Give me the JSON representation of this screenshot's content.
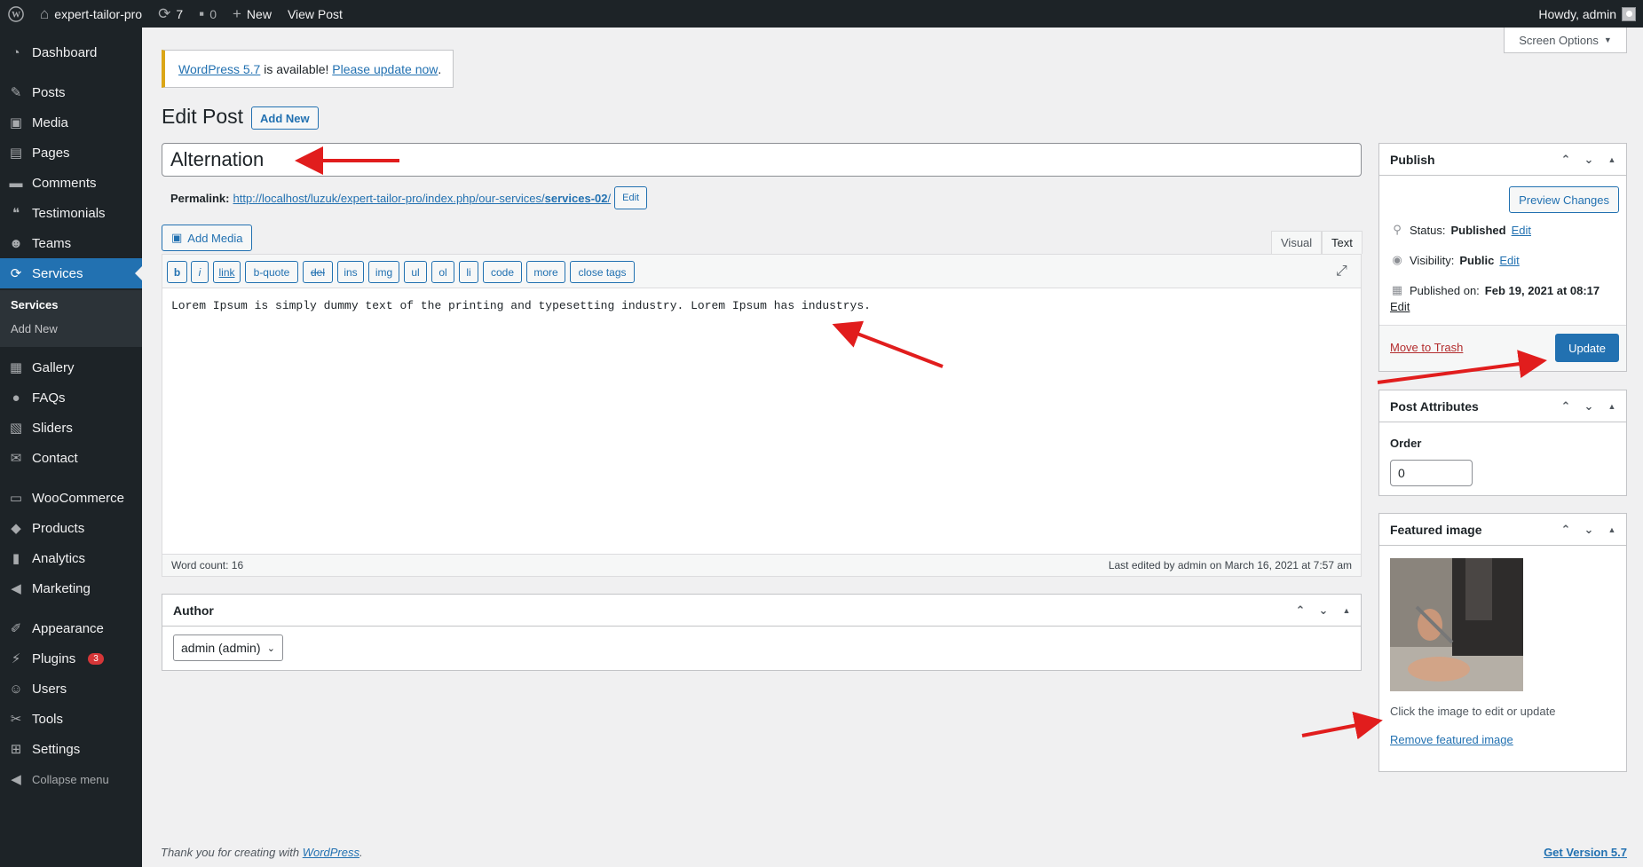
{
  "admin_bar": {
    "site_name": "expert-tailor-pro",
    "updates_count": "7",
    "comments_count": "0",
    "new_label": "New",
    "view_post_label": "View Post",
    "howdy": "Howdy, admin"
  },
  "sidebar": {
    "items": [
      {
        "label": "Dashboard",
        "icon": "dashboard-icon"
      },
      {
        "label": "Posts",
        "icon": "pin-icon"
      },
      {
        "label": "Media",
        "icon": "media-icon"
      },
      {
        "label": "Pages",
        "icon": "pages-icon"
      },
      {
        "label": "Comments",
        "icon": "comment-icon"
      },
      {
        "label": "Testimonials",
        "icon": "testimonial-icon"
      },
      {
        "label": "Teams",
        "icon": "groups-icon"
      },
      {
        "label": "Services",
        "icon": "sync-icon"
      },
      {
        "label": "Gallery",
        "icon": "gallery-icon"
      },
      {
        "label": "FAQs",
        "icon": "faq-icon"
      },
      {
        "label": "Sliders",
        "icon": "slider-icon"
      },
      {
        "label": "Contact",
        "icon": "email-icon"
      },
      {
        "label": "WooCommerce",
        "icon": "woocommerce-icon"
      },
      {
        "label": "Products",
        "icon": "products-icon"
      },
      {
        "label": "Analytics",
        "icon": "chart-icon"
      },
      {
        "label": "Marketing",
        "icon": "megaphone-icon"
      },
      {
        "label": "Appearance",
        "icon": "brush-icon"
      },
      {
        "label": "Plugins",
        "icon": "plugin-icon"
      },
      {
        "label": "Users",
        "icon": "user-icon"
      },
      {
        "label": "Tools",
        "icon": "wrench-icon"
      },
      {
        "label": "Settings",
        "icon": "settings-icon"
      }
    ],
    "submenu": {
      "current": "Services",
      "add_new": "Add New"
    },
    "plugins_badge": "3",
    "collapse_label": "Collapse menu"
  },
  "screen_options": "Screen Options",
  "notice": {
    "link1": "WordPress 5.7",
    "text": " is available! ",
    "link2": "Please update now",
    "end": "."
  },
  "page": {
    "title": "Edit Post",
    "add_new": "Add New"
  },
  "post": {
    "title": "Alternation",
    "permalink_label": "Permalink:",
    "permalink_base": "http://localhost/luzuk/expert-tailor-pro/index.php/our-services/",
    "permalink_slug": "services-02",
    "permalink_trailing": "/",
    "permalink_edit": "Edit"
  },
  "editor": {
    "add_media": "Add Media",
    "tab_visual": "Visual",
    "tab_text": "Text",
    "quicktags": [
      "b",
      "i",
      "link",
      "b-quote",
      "del",
      "ins",
      "img",
      "ul",
      "ol",
      "li",
      "code",
      "more",
      "close tags"
    ],
    "content": "Lorem Ipsum is simply dummy text of the printing and typesetting industry. Lorem Ipsum has industrys.",
    "word_count": "Word count: 16",
    "last_edited": "Last edited by admin on March 16, 2021 at 7:57 am"
  },
  "author_box": {
    "title": "Author",
    "selected": "admin (admin)"
  },
  "publish_box": {
    "title": "Publish",
    "preview": "Preview Changes",
    "status_label": "Status:",
    "status_value": "Published",
    "visibility_label": "Visibility:",
    "visibility_value": "Public",
    "published_label": "Published on:",
    "published_value": "Feb 19, 2021 at 08:17",
    "edit": "Edit",
    "trash": "Move to Trash",
    "update": "Update"
  },
  "attributes_box": {
    "title": "Post Attributes",
    "order_label": "Order",
    "order_value": "0"
  },
  "featured_box": {
    "title": "Featured image",
    "caption": "Click the image to edit or update",
    "remove": "Remove featured image"
  },
  "footer": {
    "thanks": "Thank you for creating with ",
    "wp_link": "WordPress",
    "dot": ".",
    "version": "Get Version 5.7"
  },
  "colors": {
    "admin_dark": "#1d2327",
    "accent": "#2271b1",
    "annotation_arrow": "#e11d1d"
  }
}
